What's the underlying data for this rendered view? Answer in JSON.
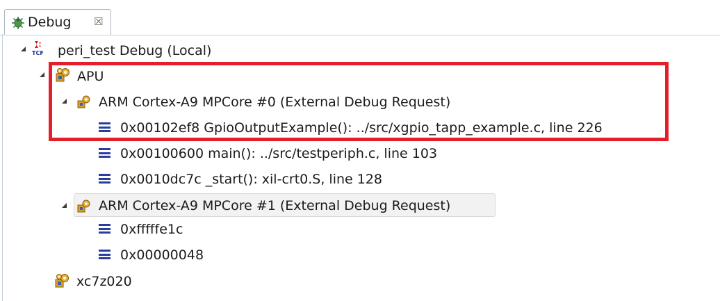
{
  "tab": {
    "label": "Debug",
    "close_glyph": "☒",
    "icon": "bug-icon"
  },
  "tree": {
    "root": {
      "label": "peri_test Debug (Local)",
      "icon": "tcf-launch-icon",
      "expanded": true
    },
    "apu": {
      "label": "APU",
      "icon": "processor-group-icon",
      "expanded": true
    },
    "core0": {
      "label": "ARM Cortex-A9 MPCore #0 (External Debug Request)",
      "icon": "core-icon",
      "expanded": true,
      "frames": [
        "0x00102ef8 GpioOutputExample(): ../src/xgpio_tapp_example.c, line 226",
        "0x00100600 main(): ../src/testperiph.c, line 103",
        "0x0010dc7c _start(): xil-crt0.S, line 128"
      ]
    },
    "core1": {
      "label": "ARM Cortex-A9 MPCore #1 (External Debug Request)",
      "icon": "core-icon",
      "expanded": true,
      "frames": [
        "0xfffffe1c",
        "0x00000048"
      ]
    },
    "device": {
      "label": "xc7z020",
      "icon": "processor-group-icon"
    }
  },
  "colors": {
    "highlight": "#e3202a",
    "stack_frame_icon": "#2a3f9d",
    "tcf_red": "#d4141b",
    "tcf_blue": "#1a2f8f",
    "gear_gold": "#c98a12"
  }
}
